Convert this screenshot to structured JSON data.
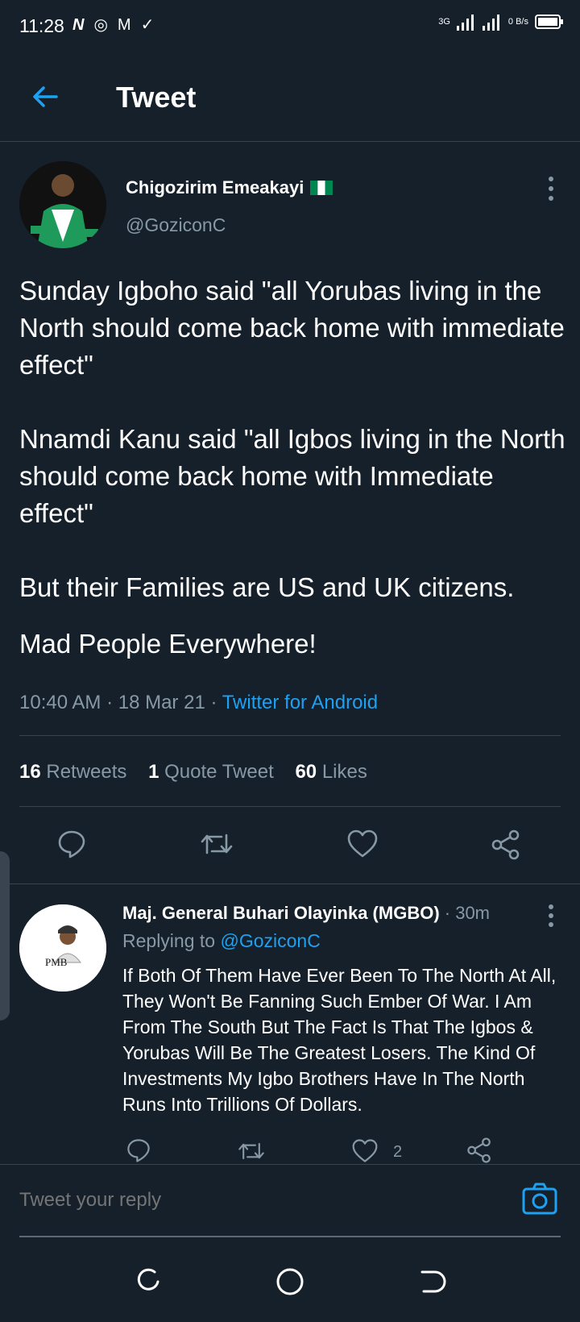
{
  "status_bar": {
    "time": "11:28",
    "network": "3G",
    "speed": "0 B/s"
  },
  "header": {
    "title": "Tweet"
  },
  "tweet": {
    "author_name": "Chigozirim Emeakayi",
    "author_handle": "@GoziconC",
    "paragraphs": [
      "Sunday Igboho said \"all Yorubas living in the North should come back home with immediate effect\"",
      "Nnamdi Kanu said \"all Igbos living in the North should come back home with Immediate effect\"",
      "But their Families are US and UK citizens.",
      "Mad People Everywhere!"
    ],
    "timestamp": "10:40 AM · 18 Mar 21 · ",
    "source": "Twitter for Android",
    "retweets_count": "16",
    "retweets_label": "Retweets",
    "quotes_count": "1",
    "quotes_label": "Quote Tweet",
    "likes_count": "60",
    "likes_label": "Likes"
  },
  "reply": {
    "author_name": "Maj. General Buhari Olayinka (MGBO)",
    "time": " · 30m",
    "replying_prefix": "Replying to ",
    "replying_to": "@GoziconC",
    "text": "If Both Of Them Have Ever Been To The North At All, They Won't Be Fanning Such Ember Of War. I Am From The South But The Fact Is That The Igbos & Yorubas Will Be The Greatest Losers. The Kind Of Investments My Igbo Brothers Have In The North Runs Into Trillions Of Dollars.",
    "like_count": "2",
    "avatar_text": "PMB"
  },
  "composer": {
    "placeholder": "Tweet your reply"
  },
  "colors": {
    "background": "#15202b",
    "accent": "#1da1f2",
    "secondary_text": "#8899a6",
    "divider": "#38444d"
  }
}
